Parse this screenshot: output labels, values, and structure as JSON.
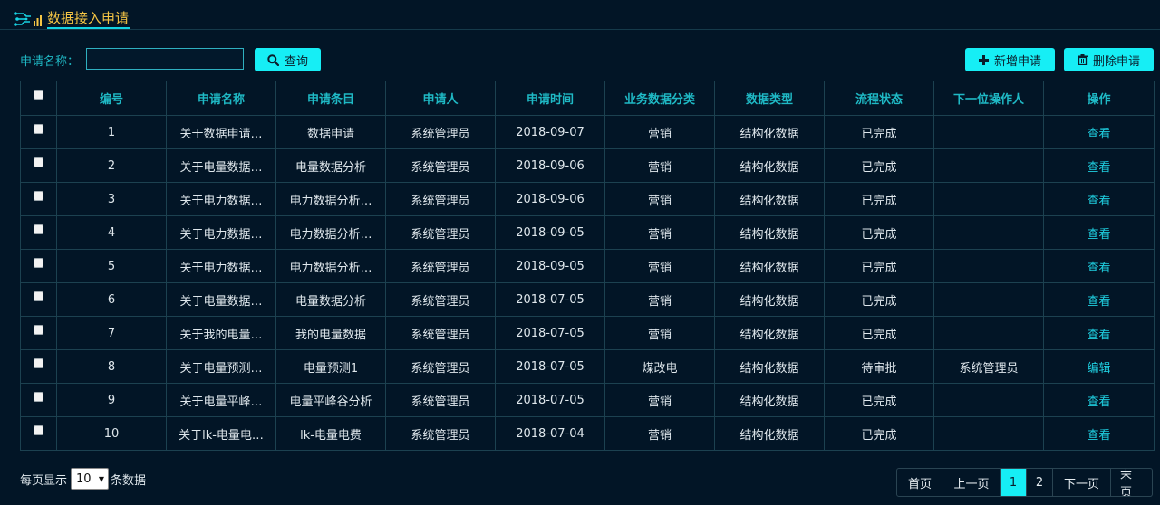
{
  "header": {
    "title": "数据接入申请"
  },
  "search": {
    "label": "申请名称：",
    "value": "",
    "query_label": "查询"
  },
  "toolbar": {
    "add_label": "新增申请",
    "delete_label": "删除申请"
  },
  "table": {
    "columns": [
      "编号",
      "申请名称",
      "申请条目",
      "申请人",
      "申请时间",
      "业务数据分类",
      "数据类型",
      "流程状态",
      "下一位操作人",
      "操作"
    ],
    "rows": [
      {
        "no": "1",
        "name": "关于数据申请…",
        "item": "数据申请",
        "applicant": "系统管理员",
        "date": "2018-09-07",
        "category": "营销",
        "type": "结构化数据",
        "status": "已完成",
        "next": "",
        "action": "查看"
      },
      {
        "no": "2",
        "name": "关于电量数据…",
        "item": "电量数据分析",
        "applicant": "系统管理员",
        "date": "2018-09-06",
        "category": "营销",
        "type": "结构化数据",
        "status": "已完成",
        "next": "",
        "action": "查看"
      },
      {
        "no": "3",
        "name": "关于电力数据…",
        "item": "电力数据分析…",
        "applicant": "系统管理员",
        "date": "2018-09-06",
        "category": "营销",
        "type": "结构化数据",
        "status": "已完成",
        "next": "",
        "action": "查看"
      },
      {
        "no": "4",
        "name": "关于电力数据…",
        "item": "电力数据分析…",
        "applicant": "系统管理员",
        "date": "2018-09-05",
        "category": "营销",
        "type": "结构化数据",
        "status": "已完成",
        "next": "",
        "action": "查看"
      },
      {
        "no": "5",
        "name": "关于电力数据…",
        "item": "电力数据分析…",
        "applicant": "系统管理员",
        "date": "2018-09-05",
        "category": "营销",
        "type": "结构化数据",
        "status": "已完成",
        "next": "",
        "action": "查看"
      },
      {
        "no": "6",
        "name": "关于电量数据…",
        "item": "电量数据分析",
        "applicant": "系统管理员",
        "date": "2018-07-05",
        "category": "营销",
        "type": "结构化数据",
        "status": "已完成",
        "next": "",
        "action": "查看"
      },
      {
        "no": "7",
        "name": "关于我的电量…",
        "item": "我的电量数据",
        "applicant": "系统管理员",
        "date": "2018-07-05",
        "category": "营销",
        "type": "结构化数据",
        "status": "已完成",
        "next": "",
        "action": "查看"
      },
      {
        "no": "8",
        "name": "关于电量预测…",
        "item": "电量预测1",
        "applicant": "系统管理员",
        "date": "2018-07-05",
        "category": "煤改电",
        "type": "结构化数据",
        "status": "待审批",
        "next": "系统管理员",
        "action": "编辑"
      },
      {
        "no": "9",
        "name": "关于电量平峰…",
        "item": "电量平峰谷分析",
        "applicant": "系统管理员",
        "date": "2018-07-05",
        "category": "营销",
        "type": "结构化数据",
        "status": "已完成",
        "next": "",
        "action": "查看"
      },
      {
        "no": "10",
        "name": "关于lk-电量电…",
        "item": "lk-电量电费",
        "applicant": "系统管理员",
        "date": "2018-07-04",
        "category": "营销",
        "type": "结构化数据",
        "status": "已完成",
        "next": "",
        "action": "查看"
      }
    ]
  },
  "footer": {
    "per_page_prefix": "每页显示",
    "per_page_value": "10",
    "per_page_suffix": "条数据",
    "pager": {
      "first": "首页",
      "prev": "上一页",
      "pages": [
        "1",
        "2"
      ],
      "current": "1",
      "next": "下一页",
      "last": "末页"
    }
  },
  "colors": {
    "background": "#021526",
    "accent": "#16eef5",
    "title": "#f4c545",
    "header_text": "#1fb9c5"
  },
  "icons": {
    "logo": "circuit-logo-icon",
    "query": "search-icon",
    "add": "plus-icon",
    "delete": "trash-icon",
    "select": "chevron-down-icon"
  }
}
